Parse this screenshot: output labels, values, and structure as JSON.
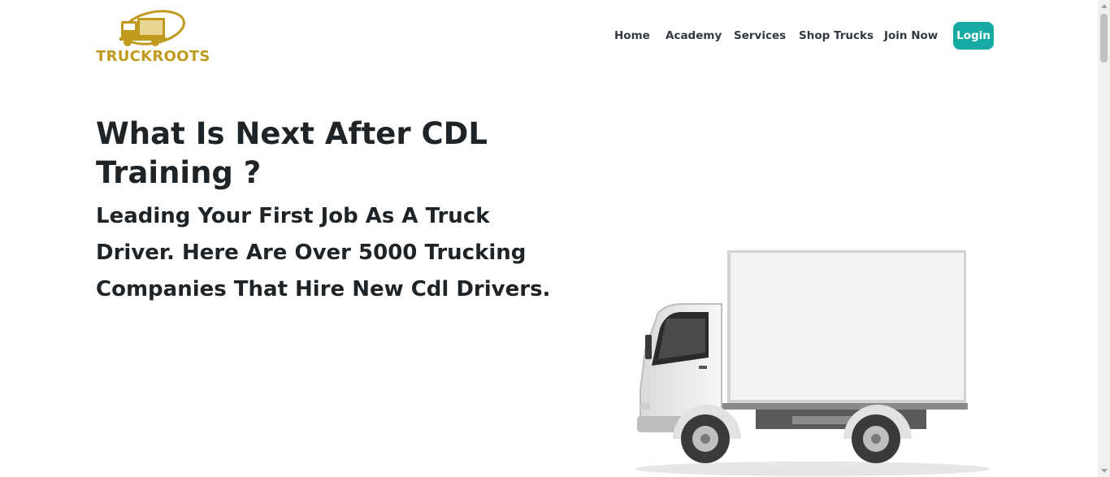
{
  "brand": {
    "name": "TRUCKROOTS",
    "color": "#c09a1e"
  },
  "nav": {
    "items": [
      {
        "label": "Home"
      },
      {
        "label": "Academy"
      },
      {
        "label": "Services"
      },
      {
        "label": "Shop Trucks"
      },
      {
        "label": "Join Now"
      }
    ],
    "login_label": "Login",
    "login_color": "#17aaa3"
  },
  "hero": {
    "title": "What Is Next After CDL Training ?",
    "subtitle": "Leading Your First Job As A Truck Driver. Here Are Over 5000 Trucking Companies That Hire New Cdl Drivers."
  },
  "icons": {
    "logo": "truck-logo-icon",
    "hero_image": "box-truck-illustration"
  }
}
